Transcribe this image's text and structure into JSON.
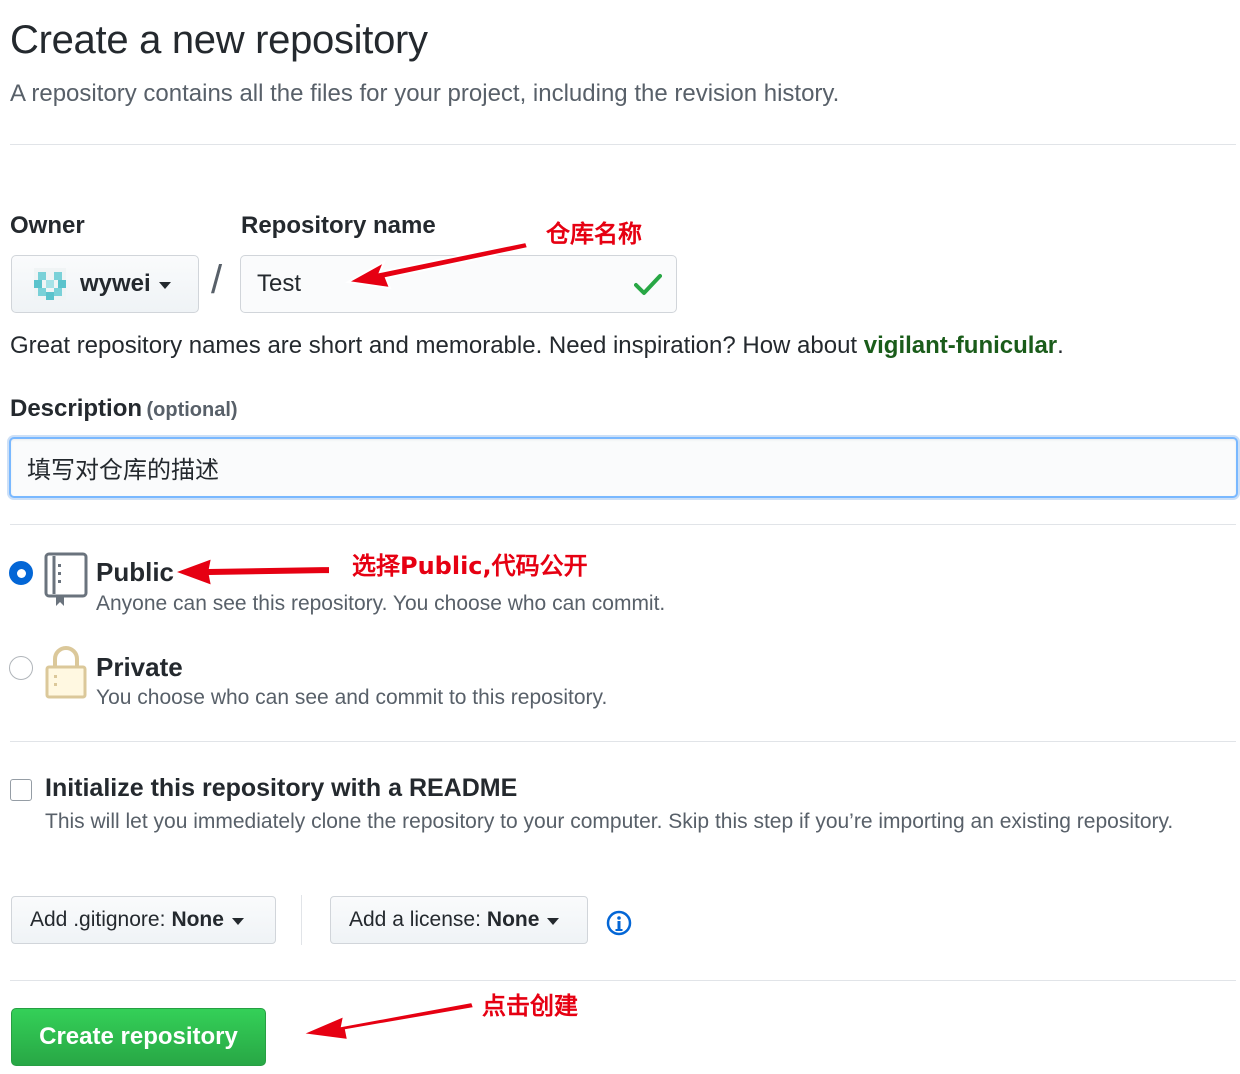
{
  "header": {
    "title": "Create a new repository",
    "subtitle": "A repository contains all the files for your project, including the revision history."
  },
  "owner": {
    "label": "Owner",
    "value": "wywei"
  },
  "repo_name": {
    "label": "Repository name",
    "value": "Test",
    "separator": "/"
  },
  "hint": {
    "text": "Great repository names are short and memorable. Need inspiration? How about ",
    "suggestion": "vigilant-funicular",
    "end": "."
  },
  "description": {
    "label": "Description",
    "optional": "(optional)",
    "value": "填写对仓库的描述"
  },
  "visibility": {
    "public": {
      "title": "Public",
      "desc": "Anyone can see this repository. You choose who can commit.",
      "selected": true
    },
    "private": {
      "title": "Private",
      "desc": "You choose who can see and commit to this repository.",
      "selected": false
    }
  },
  "readme": {
    "title": "Initialize this repository with a README",
    "desc": "This will let you immediately clone the repository to your computer. Skip this step if you’re importing an existing repository.",
    "checked": false
  },
  "gitignore": {
    "label": "Add .gitignore:",
    "value": "None"
  },
  "license": {
    "label": "Add a license:",
    "value": "None"
  },
  "create_button": "Create repository",
  "annotations": {
    "repo_name": "仓库名称",
    "public": "选择Public,代码公开",
    "create": "点击创建"
  },
  "colors": {
    "primary_green": "#28a745",
    "focus_blue": "#0366d6",
    "annotation_red": "#e60012"
  }
}
